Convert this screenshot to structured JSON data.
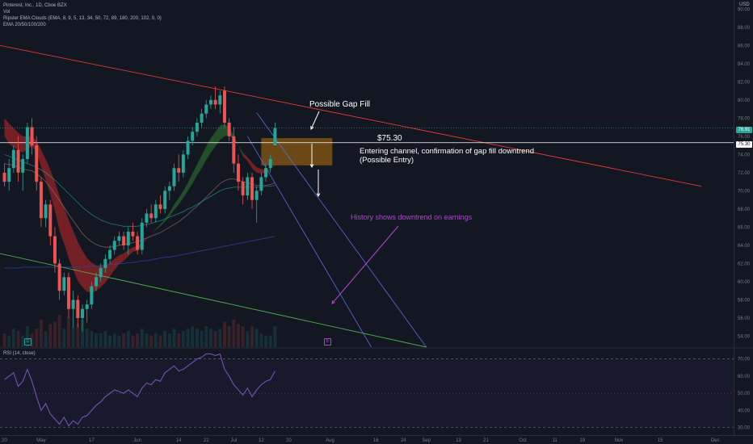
{
  "legend": {
    "symbol": "Pinterest, Inc., 1D, Cboe BZX",
    "vol": "Vol",
    "ema_clouds": "Ripster EMA Clouds (EMA, 8, 9, 5, 13, 34, 50, 72, 89, 180, 200, 102, 0, 0)",
    "ema_set": "EMA 20/50/100/200"
  },
  "rsi_label": "RSI (14, close)",
  "currency": "USD",
  "annotations": {
    "gap_fill": "Possible Gap Fill",
    "price_label": "$75.30",
    "entry_line1": "Entering channel, confirmation of gap fill downtrend",
    "entry_line2": "(Possible Entry)",
    "history": "History shows downtrend on earnings"
  },
  "axis_tags": {
    "last": "76.91",
    "line": "75.30"
  },
  "markers": {
    "dividend": "D",
    "earnings": "E"
  },
  "colors": {
    "background": "#131722",
    "up": "#26a69a",
    "down": "#ef5350",
    "cloud_green": "#2e7d32",
    "cloud_red": "#c62828",
    "trendline_red": "#e53935",
    "channel_blue": "#5b6ee1",
    "support_green": "#4caf50",
    "annotation_purple": "#b344d0",
    "rsi_line": "#7e57c2",
    "zone": "#8a5a12"
  },
  "chart_data": {
    "type": "candlestick",
    "title": "Pinterest, Inc., 1D, Cboe BZX",
    "price_axis": {
      "ticks": [
        "90.00",
        "88.00",
        "86.00",
        "84.00",
        "82.00",
        "80.00",
        "78.00",
        "76.00",
        "74.00",
        "72.00",
        "70.00",
        "68.00",
        "66.00",
        "64.00",
        "62.00",
        "60.00",
        "58.00",
        "56.00",
        "54.00"
      ],
      "ylim": [
        52.8,
        91.0
      ]
    },
    "time_axis": {
      "ticks": [
        {
          "label": "20",
          "i": 0
        },
        {
          "label": "May",
          "i": 8
        },
        {
          "label": "17",
          "i": 19
        },
        {
          "label": "Jun",
          "i": 29
        },
        {
          "label": "14",
          "i": 38
        },
        {
          "label": "22",
          "i": 44
        },
        {
          "label": "Jul",
          "i": 50
        },
        {
          "label": "12",
          "i": 56
        },
        {
          "label": "20",
          "i": 62
        },
        {
          "label": "Aug",
          "i": 71
        },
        {
          "label": "16",
          "i": 81
        },
        {
          "label": "24",
          "i": 87
        },
        {
          "label": "Sep",
          "i": 92
        },
        {
          "label": "13",
          "i": 99
        },
        {
          "label": "21",
          "i": 105
        },
        {
          "label": "Oct",
          "i": 113
        },
        {
          "label": "11",
          "i": 120
        },
        {
          "label": "19",
          "i": 126
        },
        {
          "label": "Nov",
          "i": 134
        },
        {
          "label": "15",
          "i": 143
        },
        {
          "label": "Dec",
          "i": 155
        }
      ],
      "n_slots": 159
    },
    "candles": [
      [
        72,
        73,
        70.5,
        71
      ],
      [
        71,
        73.5,
        70,
        72.5
      ],
      [
        72.5,
        75,
        72,
        74.5
      ],
      [
        74.5,
        76,
        71,
        72
      ],
      [
        72,
        74,
        70,
        73.5
      ],
      [
        73.5,
        77.5,
        73,
        77
      ],
      [
        77,
        78,
        74,
        75
      ],
      [
        75,
        76,
        70,
        71
      ],
      [
        71,
        71.5,
        66,
        67
      ],
      [
        67,
        69,
        66,
        68.5
      ],
      [
        68.5,
        69,
        64,
        65
      ],
      [
        65,
        66,
        61,
        62
      ],
      [
        62,
        62.5,
        58,
        59
      ],
      [
        59,
        61,
        58.5,
        60.5
      ],
      [
        60.5,
        61,
        56,
        57
      ],
      [
        57,
        59,
        55,
        58
      ],
      [
        58,
        58.5,
        55,
        56
      ],
      [
        56,
        57.5,
        54.5,
        57
      ],
      [
        57,
        58,
        55.5,
        57.5
      ],
      [
        57.5,
        60,
        57,
        59.5
      ],
      [
        59.5,
        61,
        59,
        60.5
      ],
      [
        60.5,
        62,
        60,
        61.5
      ],
      [
        61.5,
        63,
        61,
        62.5
      ],
      [
        62.5,
        64,
        62,
        63.5
      ],
      [
        63.5,
        65,
        63,
        64.5
      ],
      [
        64.5,
        65.5,
        64,
        65
      ],
      [
        65,
        65.5,
        63.5,
        64
      ],
      [
        64,
        66,
        63,
        65.5
      ],
      [
        65.5,
        66.5,
        64.5,
        65
      ],
      [
        65,
        65.5,
        63,
        63.5
      ],
      [
        63.5,
        67,
        63,
        66.5
      ],
      [
        66.5,
        68,
        66,
        67.5
      ],
      [
        67.5,
        68.5,
        66.5,
        67
      ],
      [
        67,
        69,
        66.5,
        68.5
      ],
      [
        68.5,
        69.5,
        67.5,
        68
      ],
      [
        68,
        70.5,
        67.5,
        70
      ],
      [
        70,
        71,
        69,
        70.5
      ],
      [
        70.5,
        73,
        70,
        72.5
      ],
      [
        72.5,
        74,
        71,
        72
      ],
      [
        72,
        74.5,
        71.5,
        74
      ],
      [
        74,
        76,
        73.5,
        75.5
      ],
      [
        75.5,
        77,
        75,
        76.5
      ],
      [
        76.5,
        78,
        76,
        77.5
      ],
      [
        77.5,
        79,
        77,
        78.5
      ],
      [
        78.5,
        80,
        78,
        79.5
      ],
      [
        79.5,
        80.5,
        79,
        80
      ],
      [
        80,
        81.5,
        79,
        79.5
      ],
      [
        79.5,
        81,
        78.5,
        80.5
      ],
      [
        81,
        81.5,
        77,
        77.5
      ],
      [
        77.5,
        78,
        75.5,
        76
      ],
      [
        76,
        77,
        72,
        73
      ],
      [
        73,
        74,
        70,
        71
      ],
      [
        71,
        71.5,
        68.5,
        69.5
      ],
      [
        69.5,
        72,
        69,
        71.5
      ],
      [
        71.5,
        72,
        68,
        69
      ],
      [
        69,
        70.5,
        66.5,
        70
      ],
      [
        70,
        72,
        69.5,
        71.5
      ],
      [
        71.5,
        73,
        71,
        72.5
      ],
      [
        72.5,
        74,
        72,
        73.5
      ],
      [
        75,
        77.5,
        75,
        76.9
      ]
    ],
    "ema_fast": [
      76,
      75.2,
      74.8,
      74.5,
      74.2,
      74.6,
      74.9,
      74.3,
      72.6,
      71.2,
      69.6,
      67.8,
      65.6,
      64.2,
      62.6,
      61.3,
      60.1,
      59.4,
      58.9,
      58.8,
      59,
      59.4,
      59.9,
      60.6,
      61.3,
      61.9,
      62.3,
      62.8,
      63.3,
      63.4,
      64,
      64.7,
      65.2,
      65.8,
      66.3,
      66.9,
      67.6,
      68.5,
      69.2,
      70,
      70.9,
      71.9,
      72.9,
      73.9,
      74.9,
      75.8,
      76.5,
      77.2,
      77.3,
      77,
      76.1,
      75,
      73.8,
      73.3,
      72.5,
      72,
      71.9,
      72,
      72.3,
      73
    ],
    "ema_fast2": [
      78,
      77.4,
      76.9,
      76.4,
      76,
      76,
      76,
      75.5,
      74.5,
      73.5,
      72.3,
      71,
      69.4,
      68.2,
      66.8,
      65.6,
      64.4,
      63.4,
      62.6,
      62.1,
      61.8,
      61.7,
      61.8,
      62.1,
      62.5,
      62.9,
      63.1,
      63.5,
      63.8,
      63.9,
      64.3,
      64.8,
      65.2,
      65.7,
      66.1,
      66.6,
      67.2,
      67.9,
      68.5,
      69.2,
      70,
      70.8,
      71.7,
      72.5,
      73.4,
      74.2,
      74.9,
      75.6,
      76,
      76.1,
      75.7,
      75,
      74.2,
      73.7,
      73.1,
      72.6,
      72.4,
      72.3,
      72.4,
      72.8
    ],
    "ema_mid": [
      73,
      72.9,
      72.8,
      72.6,
      72.4,
      72.3,
      72.2,
      71.9,
      71.5,
      71,
      70.4,
      69.7,
      68.9,
      68.2,
      67.4,
      66.7,
      66,
      65.3,
      64.8,
      64.4,
      64.1,
      63.9,
      63.8,
      63.8,
      63.9,
      64,
      64.1,
      64.2,
      64.3,
      64.4,
      64.6,
      64.8,
      65,
      65.2,
      65.4,
      65.7,
      66,
      66.3,
      66.6,
      67,
      67.4,
      67.9,
      68.3,
      68.8,
      69.3,
      69.8,
      70.3,
      70.8,
      71.1,
      71.3,
      71.3,
      71.2,
      71,
      70.9,
      70.7,
      70.6,
      70.6,
      70.6,
      70.7,
      70.9
    ],
    "ema_slow": [
      74,
      73.8,
      73.6,
      73.4,
      73.2,
      73,
      72.8,
      72.6,
      72.3,
      72,
      71.6,
      71.2,
      70.7,
      70.2,
      69.7,
      69.2,
      68.7,
      68.2,
      67.8,
      67.4,
      67.1,
      66.8,
      66.6,
      66.4,
      66.3,
      66.2,
      66.1,
      66.1,
      66.1,
      66.1,
      66.2,
      66.3,
      66.4,
      66.6,
      66.7,
      66.9,
      67.1,
      67.3,
      67.5,
      67.7,
      68,
      68.2,
      68.5,
      68.8,
      69.1,
      69.4,
      69.7,
      70,
      70.2,
      70.3,
      70.4,
      70.4,
      70.4,
      70.4,
      70.4,
      70.4,
      70.4,
      70.5,
      70.5,
      70.6
    ],
    "ema_200": [
      61.5,
      61.5,
      61.5,
      61.5,
      61.6,
      61.6,
      61.6,
      61.6,
      61.6,
      61.6,
      61.6,
      61.6,
      61.6,
      61.6,
      61.6,
      61.6,
      61.6,
      61.6,
      61.7,
      61.7,
      61.7,
      61.8,
      61.8,
      61.9,
      61.9,
      62,
      62,
      62.1,
      62.1,
      62.2,
      62.3,
      62.3,
      62.4,
      62.5,
      62.6,
      62.7,
      62.7,
      62.8,
      62.9,
      63,
      63.1,
      63.2,
      63.3,
      63.4,
      63.5,
      63.6,
      63.7,
      63.8,
      63.9,
      64,
      64.1,
      64.2,
      64.3,
      64.4,
      64.5,
      64.6,
      64.7,
      64.8,
      64.9,
      65
    ],
    "volume": [
      6,
      5,
      8,
      7,
      5,
      9,
      6,
      8,
      12,
      7,
      10,
      11,
      14,
      8,
      13,
      9,
      10,
      12,
      8,
      7,
      6,
      6,
      7,
      5,
      6,
      5,
      6,
      7,
      5,
      6,
      8,
      6,
      5,
      6,
      5,
      7,
      6,
      8,
      6,
      7,
      8,
      9,
      8,
      7,
      9,
      8,
      7,
      8,
      11,
      9,
      12,
      10,
      9,
      7,
      9,
      8,
      6,
      5,
      5,
      9
    ],
    "rsi": {
      "ylim": [
        27,
        76
      ],
      "ticks": [
        "70.00",
        "60.00",
        "50.00",
        "40.00",
        "30.00"
      ],
      "levels": [
        70,
        30
      ],
      "values": [
        58,
        60,
        62,
        54,
        57,
        64,
        57,
        48,
        40,
        44,
        38,
        35,
        32,
        36,
        31,
        34,
        32,
        36,
        37,
        40,
        43,
        45,
        48,
        50,
        52,
        51,
        50,
        52,
        50,
        48,
        53,
        56,
        55,
        58,
        57,
        62,
        64,
        66,
        63,
        64,
        66,
        68,
        70,
        71,
        73,
        73,
        72,
        73,
        64,
        60,
        55,
        52,
        49,
        53,
        48,
        52,
        55,
        57,
        58,
        63
      ]
    },
    "lines": {
      "red_trend": {
        "from": {
          "i": -1,
          "price": 86.0
        },
        "to": {
          "i": 152,
          "price": 70.5
        }
      },
      "green_support": {
        "from": {
          "i": -1,
          "price": 63.1
        },
        "to": {
          "i": 92,
          "price": 52.8
        }
      },
      "channel_upper": {
        "from": {
          "i": 55,
          "price": 78.6
        },
        "to": {
          "i": 92,
          "price": 52.8
        }
      },
      "channel_lower": {
        "from": {
          "i": 53,
          "price": 76.0
        },
        "to": {
          "i": 80,
          "price": 52.8
        }
      },
      "horizontal_75_30": 75.3,
      "last_price": 76.91
    },
    "zone": {
      "i0": 56,
      "i1": 71.5,
      "p0": 72.8,
      "p1": 75.8
    }
  }
}
